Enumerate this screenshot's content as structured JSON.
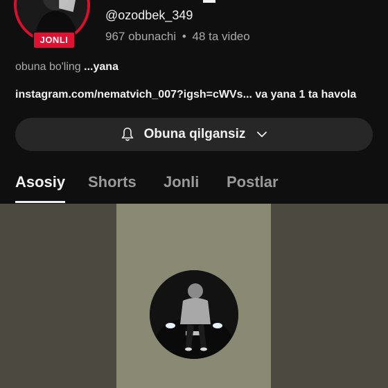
{
  "channel": {
    "live_badge": "JONLI",
    "handle": "@ozodbek_349",
    "subscribers": "967 obunachi",
    "separator": "•",
    "videos": "48 ta video",
    "description": "obuna bo'ling",
    "description_more": "...yana",
    "links": "instagram.com/nematvich_007?igsh=cWVs... va yana 1 ta havola"
  },
  "subscribe": {
    "label": "Obuna qilgansiz",
    "bell_icon": "bell-icon",
    "chevron_icon": "chevron-down-icon"
  },
  "tabs": [
    {
      "label": "Asosiy",
      "active": true
    },
    {
      "label": "Shorts",
      "active": false
    },
    {
      "label": "Jonli",
      "active": false
    },
    {
      "label": "Postlar",
      "active": false
    }
  ],
  "colors": {
    "background": "#0f0f0f",
    "live_red": "#e01234",
    "button_bg": "#272727",
    "banner_side": "#4c4a40",
    "banner_center": "#8a8974"
  }
}
